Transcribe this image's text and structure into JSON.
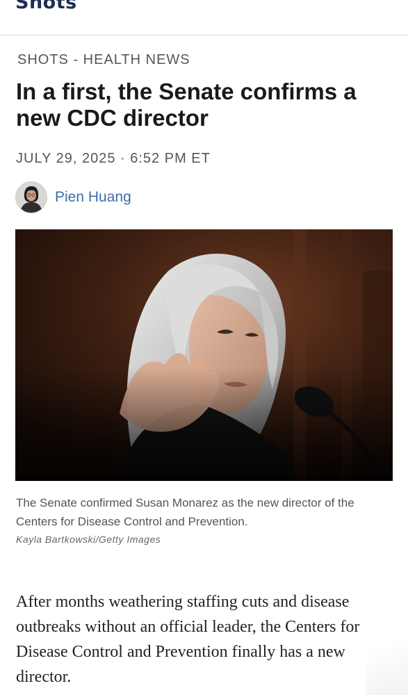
{
  "header": {
    "brand": "Shots"
  },
  "article": {
    "kicker": "SHOTS - HEALTH NEWS",
    "headline": "In a first, the Senate confirms a new CDC director",
    "dateline": "JULY 29, 2025 · 6:52 PM ET",
    "author": "Pien Huang",
    "photo": {
      "caption": "The Senate confirmed Susan Monarez as the new director of the Centers for Disease Control and Prevention.",
      "credit": "Kayla Bartkowski/Getty Images"
    },
    "body": "After months weathering staffing cuts and disease outbreaks without an official leader, the Centers for Disease Control and Prevention finally has a new director."
  },
  "colors": {
    "brand": "#1d2d53",
    "author_link": "#3a6ea8",
    "muted_text": "#555555"
  }
}
